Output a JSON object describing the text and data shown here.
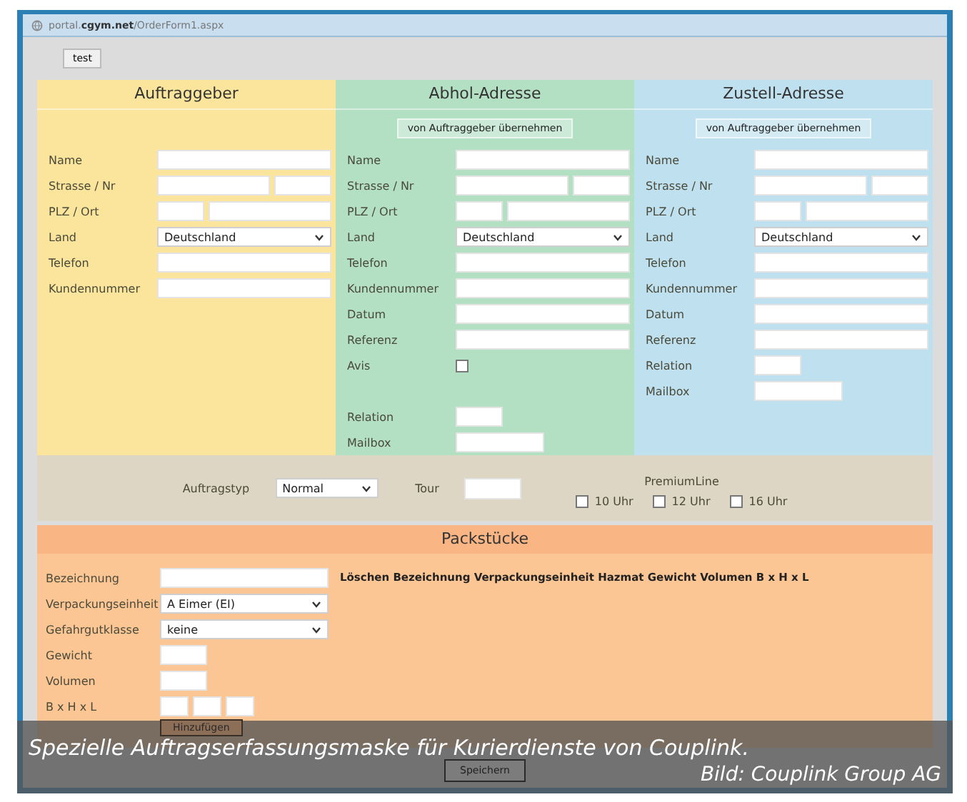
{
  "browser": {
    "url": "portal.**cgym.net**/OrderForm1.aspx"
  },
  "test_button": "test",
  "panels": [
    {
      "title": "Auftraggeber",
      "color": "#fbe59c",
      "fields": [
        {
          "label": "Name",
          "kind": "text"
        },
        {
          "label": "Strasse / Nr",
          "kind": "street"
        },
        {
          "label": "PLZ / Ort",
          "kind": "zip"
        },
        {
          "label": "Land",
          "kind": "select",
          "value": "Deutschland"
        },
        {
          "label": "Telefon",
          "kind": "text"
        },
        {
          "label": "Kundennummer",
          "kind": "text"
        }
      ]
    },
    {
      "title": "Abhol-Adresse",
      "color": "#b3dfc3",
      "copy_button": "von Auftraggeber übernehmen",
      "fields": [
        {
          "label": "Name",
          "kind": "text"
        },
        {
          "label": "Strasse / Nr",
          "kind": "street"
        },
        {
          "label": "PLZ / Ort",
          "kind": "zip"
        },
        {
          "label": "Land",
          "kind": "select",
          "value": "Deutschland"
        },
        {
          "label": "Telefon",
          "kind": "text"
        },
        {
          "label": "Kundennummer",
          "kind": "text"
        },
        {
          "label": "Datum",
          "kind": "text"
        },
        {
          "label": "Referenz",
          "kind": "text"
        },
        {
          "label": "Avis",
          "kind": "checkbox",
          "checked": false
        },
        {
          "label": "Relation",
          "kind": "short"
        },
        {
          "label": "Mailbox",
          "kind": "medium"
        }
      ]
    },
    {
      "title": "Zustell-Adresse",
      "color": "#bfe0ef",
      "copy_button": "von Auftraggeber übernehmen",
      "fields": [
        {
          "label": "Name",
          "kind": "text"
        },
        {
          "label": "Strasse / Nr",
          "kind": "street"
        },
        {
          "label": "PLZ / Ort",
          "kind": "zip"
        },
        {
          "label": "Land",
          "kind": "select",
          "value": "Deutschland"
        },
        {
          "label": "Telefon",
          "kind": "text"
        },
        {
          "label": "Kundennummer",
          "kind": "text"
        },
        {
          "label": "Datum",
          "kind": "text"
        },
        {
          "label": "Referenz",
          "kind": "text"
        },
        {
          "label": "Relation",
          "kind": "short"
        },
        {
          "label": "Mailbox",
          "kind": "medium"
        }
      ]
    }
  ],
  "order": {
    "type_label": "Auftragstyp",
    "type_value": "Normal",
    "tour_label": "Tour",
    "premium_title": "PremiumLine",
    "premium_options": [
      {
        "label": "10 Uhr",
        "checked": false
      },
      {
        "label": "12 Uhr",
        "checked": false
      },
      {
        "label": "16 Uhr",
        "checked": false
      }
    ]
  },
  "pieces": {
    "title": "Packstücke",
    "table_header": "Löschen Bezeichnung Verpackungseinheit Hazmat Gewicht Volumen B x H x L",
    "fields": [
      {
        "label": "Bezeichnung",
        "kind": "wide"
      },
      {
        "label": "Verpackungseinheit",
        "kind": "select",
        "value": "A Eimer (EI)"
      },
      {
        "label": "Gefahrgutklasse",
        "kind": "select",
        "value": "keine"
      },
      {
        "label": "Gewicht",
        "kind": "short"
      },
      {
        "label": "Volumen",
        "kind": "short"
      },
      {
        "label": "B x H x L",
        "kind": "triple"
      }
    ],
    "add_button": "Hinzufügen"
  },
  "save_button": "Speichern",
  "caption": {
    "text": "Spezielle Auftragserfassungsmaske für Kurierdienste von Couplink.",
    "credit": "Bild: Couplink Group AG"
  }
}
